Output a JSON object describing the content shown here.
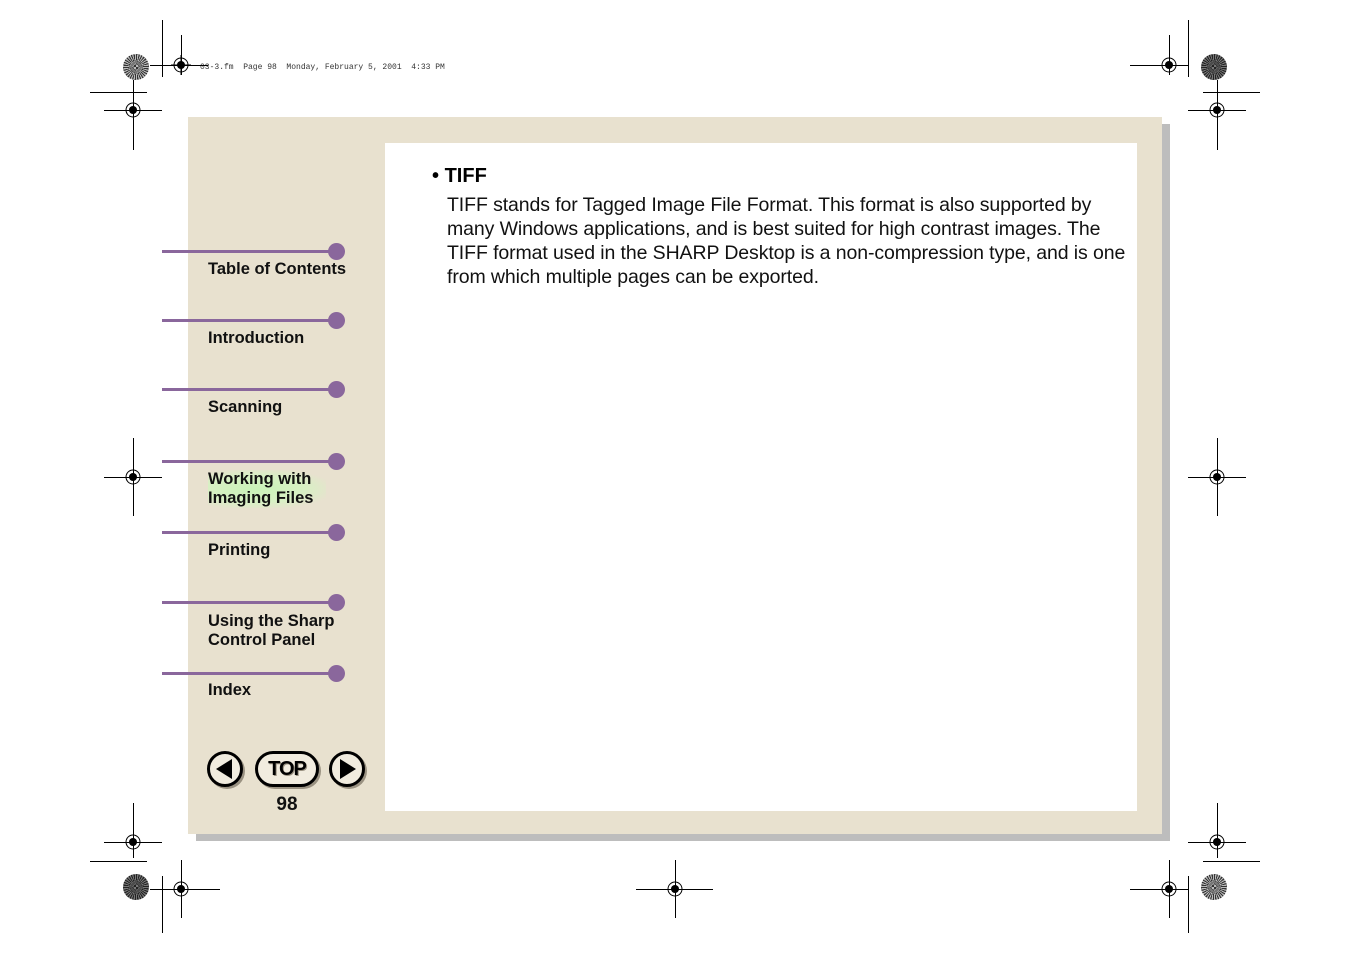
{
  "slug": {
    "text": "03-3.fm  Page 98  Monday, February 5, 2001  4:33 PM"
  },
  "content": {
    "heading": "TIFF",
    "bullet": "•",
    "paragraph": "TIFF stands for Tagged Image File Format. This format is also supported by many Windows applications, and is best suited for high contrast images. The TIFF format used in the SHARP Desktop is a non-compression type, and is one from which multiple pages can be exported."
  },
  "nav": {
    "items": [
      {
        "label": "Table of Contents",
        "active": false
      },
      {
        "label": "Introduction",
        "active": false
      },
      {
        "label": "Scanning",
        "active": false
      },
      {
        "label": "Working with Imaging Files",
        "active": true
      },
      {
        "label": "Printing",
        "active": false
      },
      {
        "label": "Using the Sharp Control Panel",
        "active": false
      },
      {
        "label": "Index",
        "active": false
      }
    ]
  },
  "navigation_buttons": {
    "previous_icon": "left-triangle-icon",
    "top_label": "TOP",
    "next_icon": "right-triangle-icon"
  },
  "page_number": "98",
  "colors": {
    "nav_accent": "#8a679c",
    "frame": "#e8e1cf",
    "highlight": "#c9f2b8"
  }
}
